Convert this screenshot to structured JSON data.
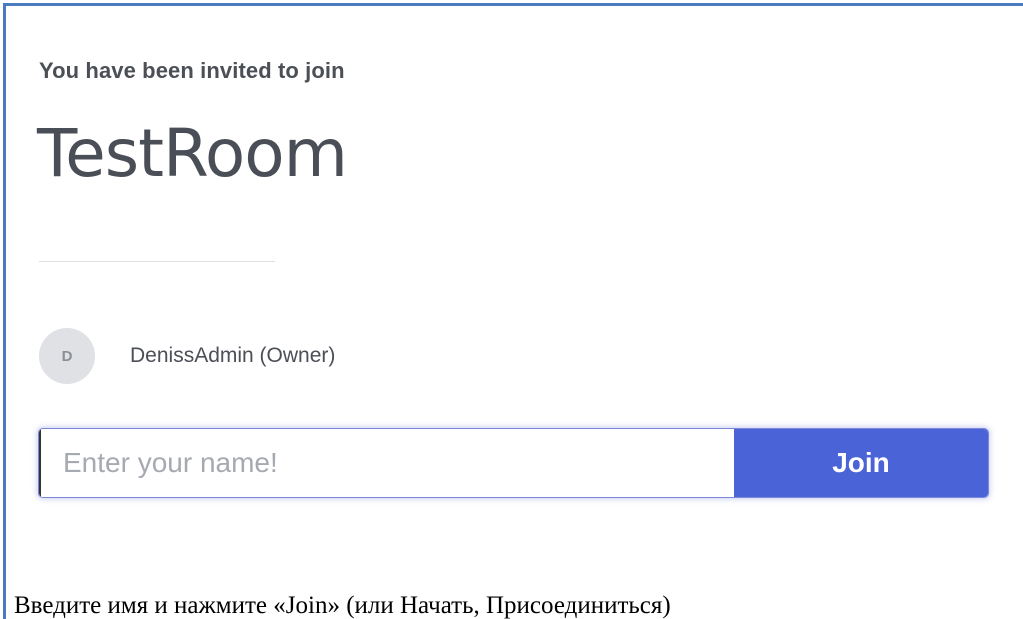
{
  "invite": {
    "subtitle": "You have been invited to join",
    "room_name": "TestRoom"
  },
  "owner": {
    "avatar_initial": "D",
    "name": "DenissAdmin (Owner)"
  },
  "form": {
    "name_placeholder": "Enter your name!",
    "name_value": "",
    "join_label": "Join"
  },
  "caption": {
    "text": "Введите имя и нажмите «Join» (или Начать, Присоединиться)"
  },
  "colors": {
    "frame_border": "#4a7bbf",
    "join_button": "#4a63d6",
    "text": "#4b4f56"
  }
}
